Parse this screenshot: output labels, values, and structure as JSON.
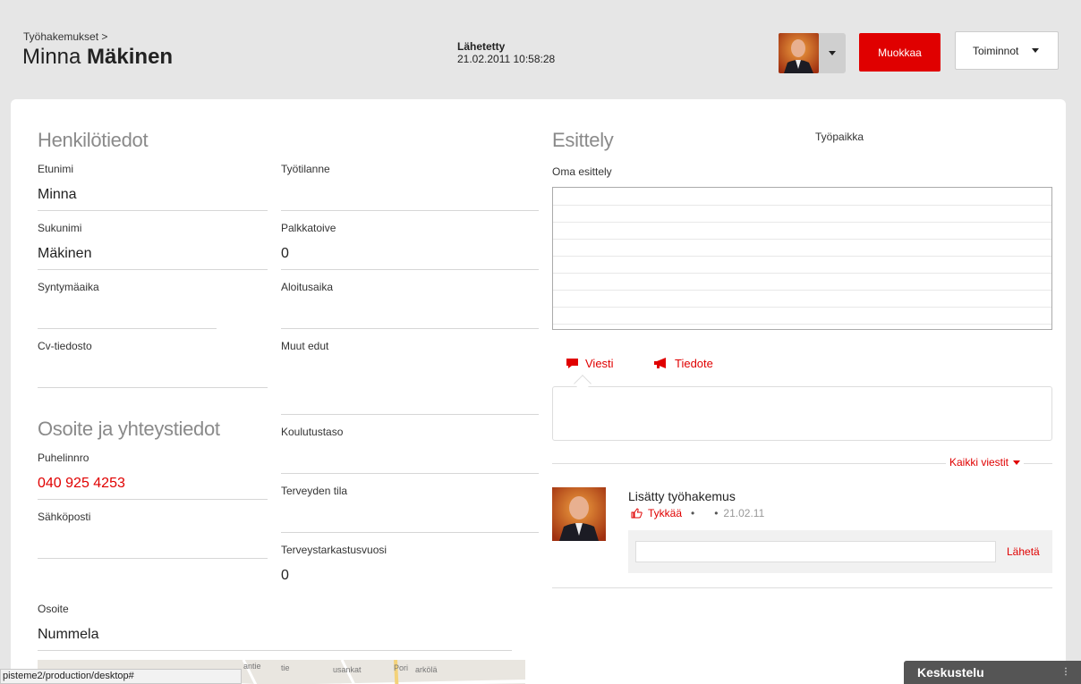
{
  "header": {
    "breadcrumb": "Työhakemukset >",
    "first_name": "Minna",
    "last_name": "Mäkinen",
    "sent_label": "Lähetetty",
    "sent_value": "21.02.2011 10:58:28",
    "edit_label": "Muokkaa",
    "actions_label": "Toiminnot"
  },
  "personal": {
    "title": "Henkilötiedot",
    "first_name_label": "Etunimi",
    "first_name_value": "Minna",
    "last_name_label": "Sukunimi",
    "last_name_value": "Mäkinen",
    "birth_label": "Syntymäaika",
    "cv_label": "Cv-tiedosto",
    "work_status_label": "Työtilanne",
    "salary_label": "Palkkatoive",
    "salary_value": "0",
    "start_label": "Aloitusaika",
    "benefits_label": "Muut edut",
    "education_label": "Koulutustaso",
    "health_label": "Terveyden tila",
    "checkup_label": "Terveystarkastusvuosi",
    "checkup_value": "0"
  },
  "contact": {
    "title": "Osoite ja yhteystiedot",
    "phone_label": "Puhelinnro",
    "phone_value": "040 925 4253",
    "email_label": "Sähköposti",
    "address_label": "Osoite",
    "address_value": "Nummela"
  },
  "intro": {
    "title": "Esittely",
    "workplace_label": "Työpaikka",
    "own_intro_label": "Oma esittely"
  },
  "tabs": {
    "message": "Viesti",
    "notice": "Tiedote"
  },
  "feed": {
    "all_messages": "Kaikki viestit",
    "post_title": "Lisätty työhakemus",
    "like": "Tykkää",
    "bullet": "•",
    "date": "21.02.11",
    "send": "Lähetä"
  },
  "map": {
    "labels": [
      "antie",
      "tie",
      "usankat",
      "Pori",
      "arkölä"
    ]
  },
  "status_url": "pisteme2/production/desktop#",
  "chat": {
    "label": "Keskustelu",
    "dots": "⋮"
  },
  "colors": {
    "accent": "#e00000",
    "background": "#e6e6e6",
    "section_title": "#8a8a8a"
  }
}
